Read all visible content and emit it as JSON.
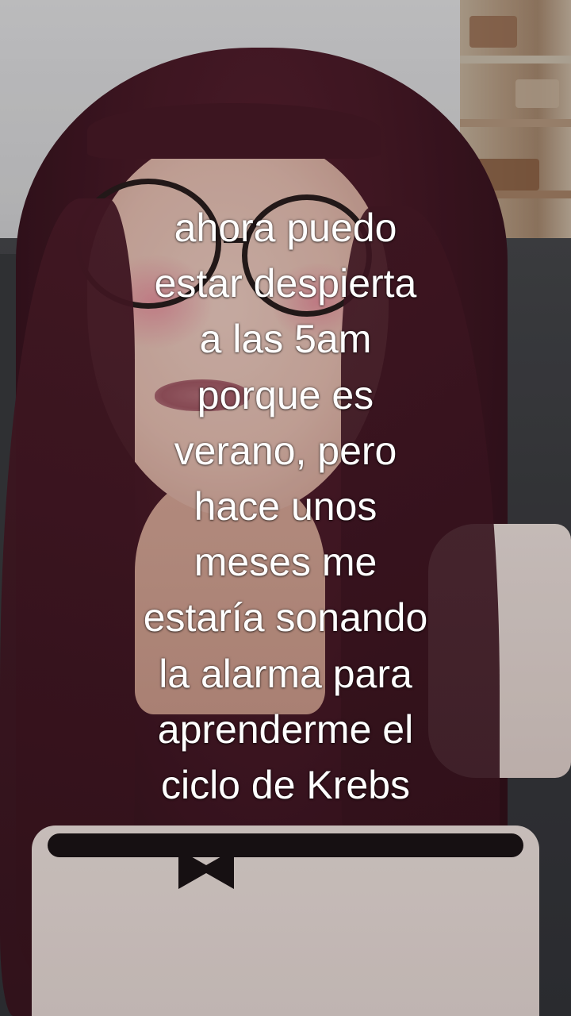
{
  "caption": {
    "lines": [
      "ahora puedo",
      "estar despierta",
      "a las 5am",
      "porque es",
      "verano, pero",
      "hace unos",
      "meses me",
      "estaría sonando",
      "la alarma para",
      "aprenderme el",
      "ciclo de Krebs"
    ]
  },
  "colors": {
    "caption_text": "#ffffff",
    "hair": "#4a1a28",
    "sofa": "#3c3d41",
    "wall": "#dcdcde"
  }
}
